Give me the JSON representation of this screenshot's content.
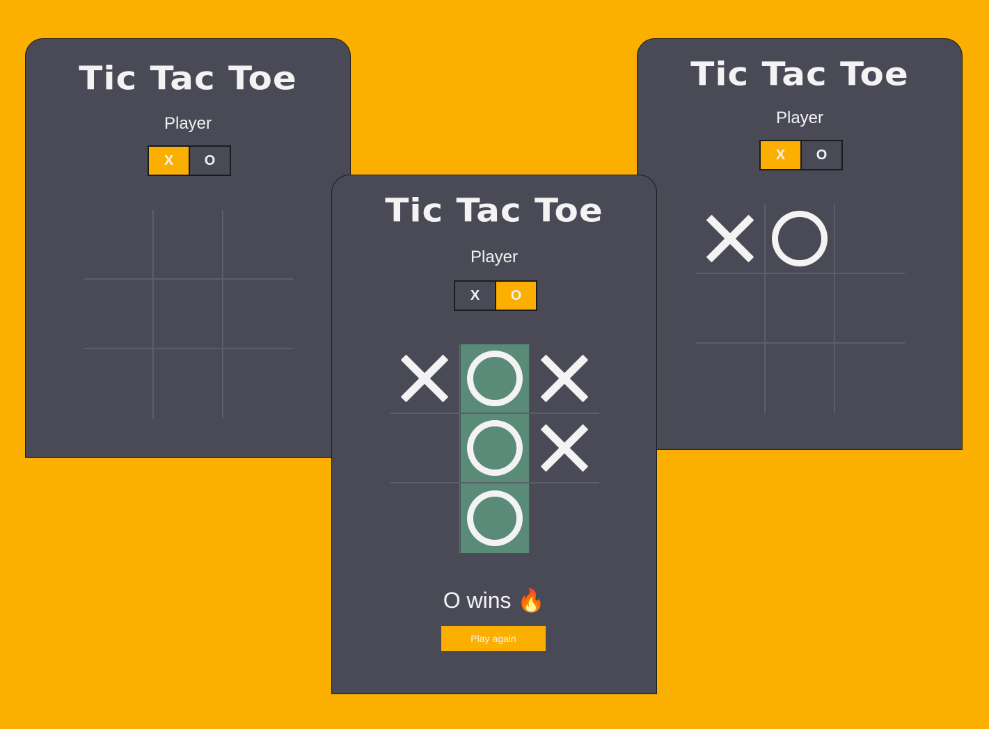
{
  "colors": {
    "background": "#FBAF00",
    "card": "#494A56",
    "accent": "#FBAF00",
    "win_highlight": "#5A8B78",
    "mark": "#F3F3F3"
  },
  "screens": [
    {
      "title": "Tic Tac Toe",
      "player_label": "Player",
      "options": [
        "X",
        "O"
      ],
      "active_player": "X",
      "board": [
        "",
        "",
        "",
        "",
        "",
        "",
        "",
        "",
        ""
      ],
      "winning_cells": []
    },
    {
      "title": "Tic Tac Toe",
      "player_label": "Player",
      "options": [
        "X",
        "O"
      ],
      "active_player": "X",
      "board": [
        "X",
        "O",
        "",
        "",
        "",
        "",
        "",
        "",
        ""
      ],
      "winning_cells": []
    },
    {
      "title": "Tic Tac Toe",
      "player_label": "Player",
      "options": [
        "X",
        "O"
      ],
      "active_player": "O",
      "board": [
        "X",
        "O",
        "X",
        "",
        "O",
        "X",
        "",
        "O",
        ""
      ],
      "winning_cells": [
        1,
        4,
        7
      ],
      "result_text": "O wins",
      "result_icon": "fire-icon",
      "play_again_label": "Play again"
    }
  ]
}
